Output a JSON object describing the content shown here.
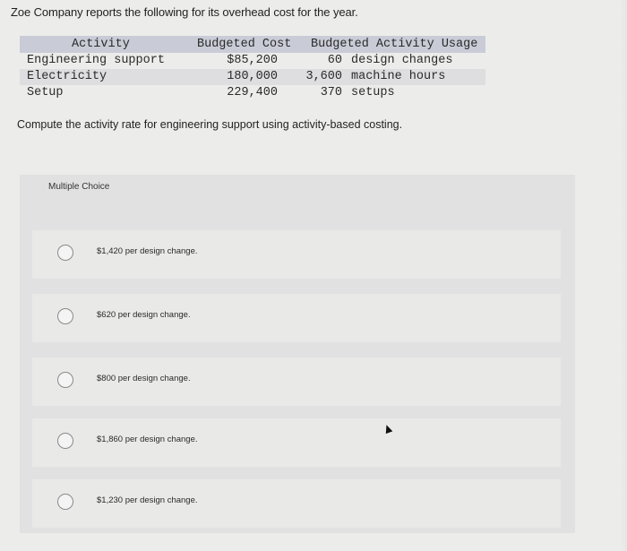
{
  "question": {
    "intro": "Zoe Company reports the following for its overhead cost for the year.",
    "prompt": "Compute the activity rate for engineering support using activity-based costing."
  },
  "table": {
    "headers": {
      "activity": "Activity",
      "budgeted_cost": "Budgeted Cost",
      "budgeted_activity_usage": "Budgeted Activity Usage"
    },
    "rows": [
      {
        "activity": "Engineering support",
        "cost": "$85,200",
        "qty": "60",
        "unit": "design changes"
      },
      {
        "activity": "Electricity",
        "cost": "180,000",
        "qty": "3,600",
        "unit": "machine hours"
      },
      {
        "activity": "Setup",
        "cost": "229,400",
        "qty": "370",
        "unit": "setups"
      }
    ]
  },
  "multiple_choice": {
    "label": "Multiple Choice",
    "options": [
      {
        "text": "$1,420 per design change.",
        "selected": false
      },
      {
        "text": "$620 per design change.",
        "selected": false
      },
      {
        "text": "$800 per design change.",
        "selected": false
      },
      {
        "text": "$1,860 per design change.",
        "selected": false
      },
      {
        "text": "$1,230 per design change.",
        "selected": false
      }
    ]
  }
}
